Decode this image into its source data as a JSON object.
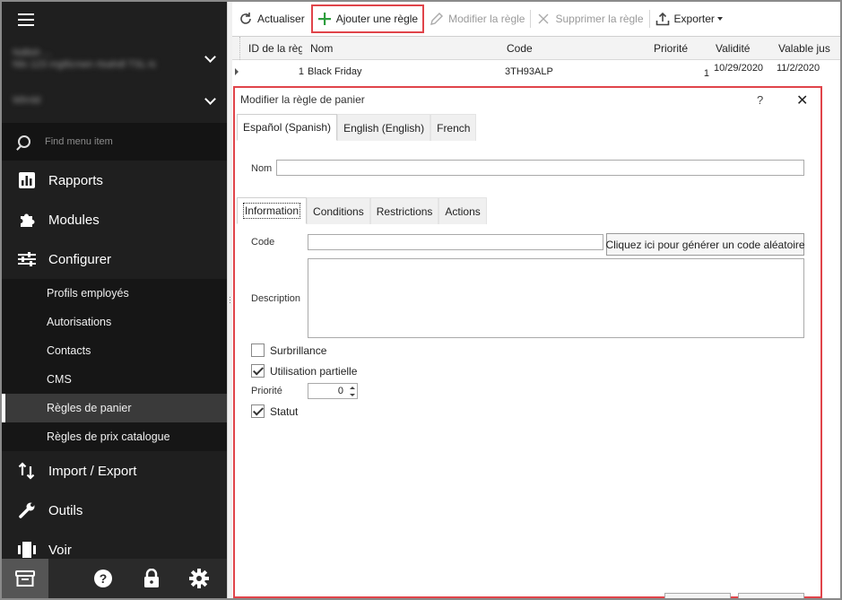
{
  "sidebar": {
    "blurred_rows": [
      {
        "line1": "Ndtlsh ...",
        "line2": "Nlo 123 mgtlicnwn rtsahdl TSL-lc"
      },
      {
        "line1": "Wlrnld"
      }
    ],
    "search_placeholder": "Find menu item",
    "nav": {
      "rapports": "Rapports",
      "modules": "Modules",
      "configurer": "Configurer",
      "import_export": "Import / Export",
      "outils": "Outils",
      "voir": "Voir"
    },
    "sub_items": [
      "Profils employés",
      "Autorisations",
      "Contacts",
      "CMS",
      "Règles de panier",
      "Règles de prix catalogue"
    ]
  },
  "toolbar": {
    "refresh": "Actualiser",
    "add": "Ajouter une règle",
    "edit": "Modifier la règle",
    "delete": "Supprimer la règle",
    "export": "Exporter"
  },
  "grid": {
    "headers": [
      "ID de la règ",
      "Nom",
      "Code",
      "Priorité",
      "Validité",
      "Valable jus"
    ],
    "rows": [
      {
        "id": "1",
        "name": "Black Friday",
        "code": "3TH93ALP",
        "priority": "1",
        "valid_from": "10/29/2020",
        "valid_to": "11/2/2020"
      }
    ]
  },
  "dialog": {
    "title": "Modifier la règle de panier",
    "help": "?",
    "close": "✕",
    "lang_tabs": [
      "Español (Spanish)",
      "English (English)",
      "French"
    ],
    "name_label": "Nom",
    "name_value": "",
    "info_tabs": [
      "Information",
      "Conditions",
      "Restrictions",
      "Actions"
    ],
    "code_label": "Code",
    "code_value": "",
    "generate_button": "Cliquez ici pour générer un code aléatoire",
    "description_label": "Description",
    "checkboxes": {
      "highlight": {
        "label": "Surbrillance",
        "checked": false
      },
      "partial": {
        "label": "Utilisation partielle",
        "checked": true
      },
      "status": {
        "label": "Statut",
        "checked": true
      }
    },
    "priority_label": "Priorité",
    "priority_value": "0"
  },
  "colors": {
    "sidebar_bg": "#1f1f1f",
    "highlight_red": "#e0444a",
    "add_icon_green": "#2e9e3e"
  }
}
